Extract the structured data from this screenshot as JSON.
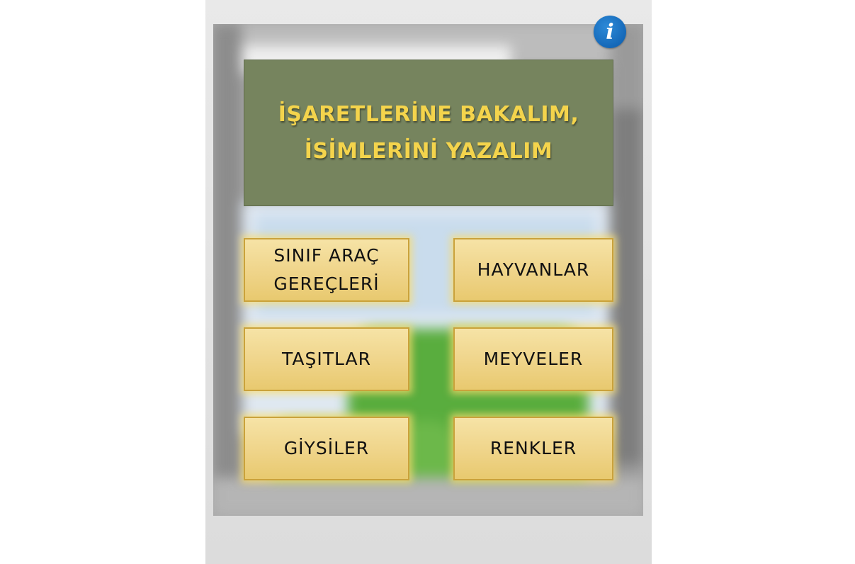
{
  "info_button": {
    "glyph": "i",
    "icon": "info-icon",
    "color": "#1568b8"
  },
  "title": {
    "text": "İŞARETLERİNE BAKALIM,\nİSİMLERİNİ YAZALIM",
    "color": "#f4d44c",
    "board_color": "#76845e"
  },
  "categories": [
    {
      "label": "SINIF ARAÇ\nGEREÇLERİ"
    },
    {
      "label": "HAYVANLAR"
    },
    {
      "label": "TAŞITLAR"
    },
    {
      "label": "MEYVELER"
    },
    {
      "label": "GİYSİLER"
    },
    {
      "label": "RENKLER"
    }
  ],
  "button_color": "#efd489"
}
